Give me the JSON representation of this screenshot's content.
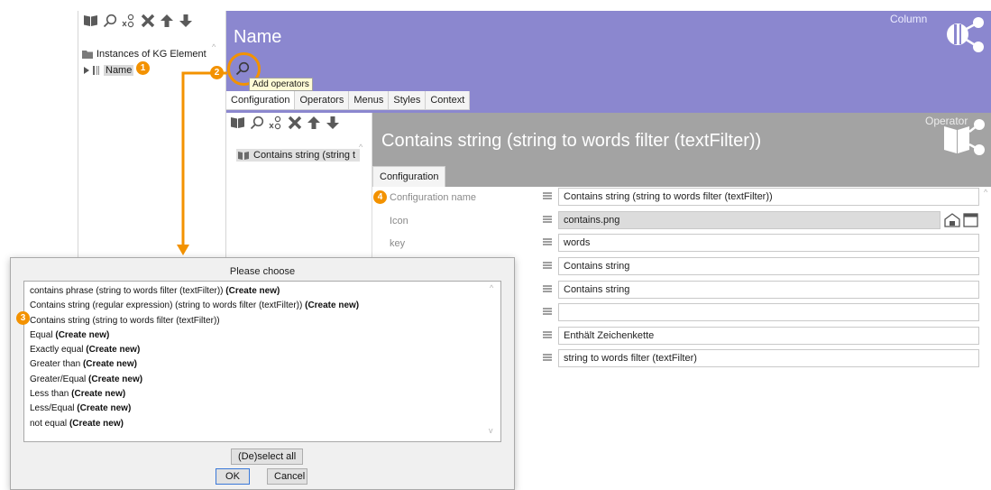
{
  "colors": {
    "accent": "#f39200",
    "column_header": "#8b87cf",
    "operator_header": "#a3a3a3",
    "folder": "#6b6b6b"
  },
  "outer_tree": {
    "toolbar_icons": [
      "book-icon",
      "search-icon",
      "filter-x-icon",
      "delete-icon",
      "move-up-icon",
      "move-down-icon"
    ],
    "root_label": "Instances of KG Element",
    "child_label": "Name"
  },
  "column": {
    "title": "Name",
    "type_label": "Column",
    "tooltip": "Add operators",
    "tabs": [
      "Configuration",
      "Operators",
      "Menus",
      "Styles",
      "Context"
    ]
  },
  "operator": {
    "list_item": "Contains string (string t",
    "title": "Contains string (string to words filter (textFilter))",
    "type_label": "Operator",
    "tab": "Configuration",
    "properties": [
      {
        "label": "Configuration name",
        "value": "Contains string (string to words filter (textFilter))"
      },
      {
        "label": "Icon",
        "value": "contains.png"
      },
      {
        "label": "key",
        "value": "words"
      },
      {
        "label": "",
        "value": "Contains string"
      },
      {
        "label": "",
        "value": "Contains string"
      },
      {
        "label": "",
        "value": ""
      },
      {
        "label": "",
        "value": "Enthält Zeichenkette"
      },
      {
        "label": "",
        "value": "string to words filter (textFilter)"
      }
    ]
  },
  "dialog": {
    "title": "Please choose",
    "choices": [
      {
        "text": "contains phrase (string to words filter (textFilter))",
        "suffix": "(Create new)"
      },
      {
        "text": "Contains string (regular expression) (string to words filter (textFilter))",
        "suffix": "(Create new)"
      },
      {
        "text": "Contains string (string to words filter (textFilter))",
        "suffix": ""
      },
      {
        "text": "Equal",
        "suffix": "(Create new)"
      },
      {
        "text": "Exactly equal",
        "suffix": "(Create new)"
      },
      {
        "text": "Greater than",
        "suffix": "(Create new)"
      },
      {
        "text": "Greater/Equal",
        "suffix": "(Create new)"
      },
      {
        "text": "Less than",
        "suffix": "(Create new)"
      },
      {
        "text": "Less/Equal",
        "suffix": "(Create new)"
      },
      {
        "text": "not equal",
        "suffix": "(Create new)"
      }
    ],
    "deselect_label": "(De)select all",
    "ok_label": "OK",
    "cancel_label": "Cancel"
  },
  "badges": [
    "1",
    "2",
    "3",
    "4"
  ]
}
